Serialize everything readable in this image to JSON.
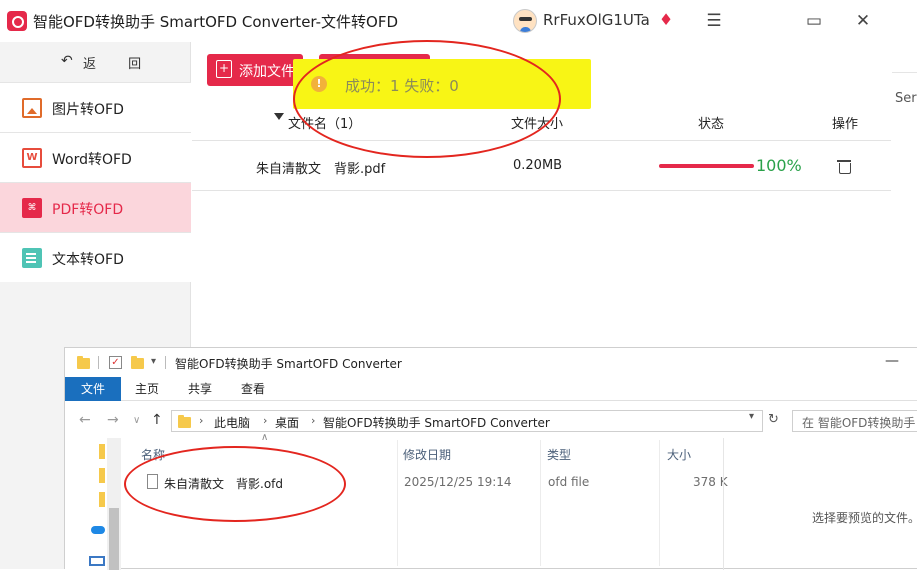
{
  "app": {
    "title": "智能OFD转换助手 SmartOFD Converter-文件转OFD",
    "username": "RrFuxOlG1UTa"
  },
  "window_controls": {
    "menu_icon": "hamburger-icon",
    "maximize_icon": "maximize-icon",
    "close_icon": "close-icon"
  },
  "sidebar": {
    "back_label": "返 回",
    "items": [
      {
        "label": "图片转OFD",
        "icon": "image-icon",
        "active": false
      },
      {
        "label": "Word转OFD",
        "icon": "word-icon",
        "active": false
      },
      {
        "label": "PDF转OFD",
        "icon": "pdf-icon",
        "active": true
      },
      {
        "label": "文本转OFD",
        "icon": "text-file-icon",
        "active": false
      }
    ]
  },
  "toolbar": {
    "add_file_label": "添加文件",
    "right_fragment": "Ser"
  },
  "toast": {
    "text": "成功：1   失败：0"
  },
  "table": {
    "headers": {
      "filename": "文件名（1）",
      "size": "文件大小",
      "status": "状态",
      "actions": "操作"
    },
    "rows": [
      {
        "filename": "朱自清散文　背影.pdf",
        "size": "0.20MB",
        "progress_percent": 100,
        "progress_label": "100%"
      }
    ]
  },
  "explorer": {
    "title": "智能OFD转换助手 SmartOFD Converter",
    "ribbon_tabs": [
      "文件",
      "主页",
      "共享",
      "查看"
    ],
    "breadcrumbs": [
      "此电脑",
      "桌面",
      "智能OFD转换助手 SmartOFD Converter"
    ],
    "search_placeholder": "在 智能OFD转换助手 ...",
    "columns": {
      "name": "名称",
      "modified": "修改日期",
      "type": "类型",
      "size": "大小"
    },
    "files": [
      {
        "name": "朱自清散文　背影.ofd",
        "modified": "2025/12/25 19:14",
        "type": "ofd file",
        "size": "378 K"
      }
    ],
    "preview_text": "选择要预览的文件。"
  },
  "colors": {
    "accent": "#e5294a",
    "active_nav_bg": "#fbd6dc",
    "toast_bg": "#f8f515",
    "progress_text": "#2aa14a",
    "annotation": "#e3261f",
    "explorer_file_tab": "#1a6fbe"
  }
}
